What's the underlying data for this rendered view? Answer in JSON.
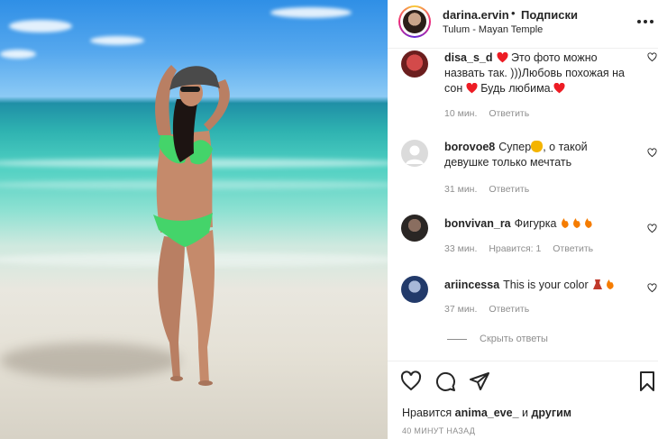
{
  "header": {
    "username": "darina.ervin",
    "dot": "•",
    "follow_label": "Подписки",
    "location": "Tulum - Mayan Temple",
    "more_icon": "more-horizontal-icon"
  },
  "comments": [
    {
      "username": "disa_s_d",
      "text_1": "Это фото можно назвать так. )))Любовь похожая на сон",
      "text_2": "Будь любима.",
      "time": "10 мин.",
      "reply_label": "Ответить"
    },
    {
      "username": "borovoe8",
      "text_1": "Супер",
      "text_2": ", о такой девушке только мечтать",
      "time": "31 мин.",
      "reply_label": "Ответить"
    },
    {
      "username": "bonvivan_ra",
      "text_1": "Фигурка",
      "time": "33 мин.",
      "likes_label": "Нравится: 1",
      "reply_label": "Ответить"
    },
    {
      "username": "ariincessa",
      "text_1": "This is your color",
      "time": "37 мин.",
      "reply_label": "Ответить"
    }
  ],
  "hide_replies_label": "Скрыть ответы",
  "likes": {
    "prefix": "Нравится",
    "user": "anima_eve_",
    "middle": "и",
    "others": "другим"
  },
  "time_ago": "40 МИНУТ НАЗАД",
  "colors": {
    "text": "#262626",
    "muted": "#8e8e8e",
    "heart_red": "#ed1c24",
    "border": "#efefef"
  }
}
